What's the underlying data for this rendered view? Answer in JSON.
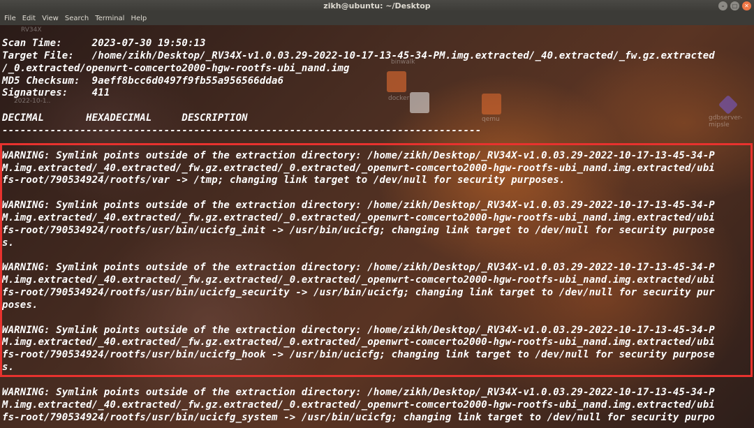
{
  "window": {
    "title": "zikh@ubuntu: ~/Desktop",
    "controls": [
      "minimize-icon",
      "maximize-icon",
      "close-icon"
    ]
  },
  "menu": [
    "File",
    "Edit",
    "View",
    "Search",
    "Terminal",
    "Help"
  ],
  "desktop_labels": [
    "binwalk",
    "qemu",
    "gdbserver-mipsle",
    "2022-10-1..",
    "RV34X",
    "docker"
  ],
  "colors": {
    "highlight": "#e8322e",
    "text": "#ffffff",
    "titlebar": "#3c3b37"
  },
  "terminal": {
    "lines": [
      "Scan Time:     2023-07-30 19:50:13",
      "Target File:   /home/zikh/Desktop/_RV34X-v1.0.03.29-2022-10-17-13-45-34-PM.img.extracted/_40.extracted/_fw.gz.extracted",
      "/_0.extracted/openwrt-comcerto2000-hgw-rootfs-ubi_nand.img",
      "MD5 Checksum:  9aeff8bcc6d0497f9fb55a956566dda6",
      "Signatures:    411",
      "",
      "DECIMAL       HEXADECIMAL     DESCRIPTION",
      "--------------------------------------------------------------------------------",
      "",
      "WARNING: Symlink points outside of the extraction directory: /home/zikh/Desktop/_RV34X-v1.0.03.29-2022-10-17-13-45-34-P",
      "M.img.extracted/_40.extracted/_fw.gz.extracted/_0.extracted/_openwrt-comcerto2000-hgw-rootfs-ubi_nand.img.extracted/ubi",
      "fs-root/790534924/rootfs/var -> /tmp; changing link target to /dev/null for security purposes.",
      "",
      "WARNING: Symlink points outside of the extraction directory: /home/zikh/Desktop/_RV34X-v1.0.03.29-2022-10-17-13-45-34-P",
      "M.img.extracted/_40.extracted/_fw.gz.extracted/_0.extracted/_openwrt-comcerto2000-hgw-rootfs-ubi_nand.img.extracted/ubi",
      "fs-root/790534924/rootfs/usr/bin/ucicfg_init -> /usr/bin/ucicfg; changing link target to /dev/null for security purpose",
      "s.",
      "",
      "WARNING: Symlink points outside of the extraction directory: /home/zikh/Desktop/_RV34X-v1.0.03.29-2022-10-17-13-45-34-P",
      "M.img.extracted/_40.extracted/_fw.gz.extracted/_0.extracted/_openwrt-comcerto2000-hgw-rootfs-ubi_nand.img.extracted/ubi",
      "fs-root/790534924/rootfs/usr/bin/ucicfg_security -> /usr/bin/ucicfg; changing link target to /dev/null for security pur",
      "poses.",
      "",
      "WARNING: Symlink points outside of the extraction directory: /home/zikh/Desktop/_RV34X-v1.0.03.29-2022-10-17-13-45-34-P",
      "M.img.extracted/_40.extracted/_fw.gz.extracted/_0.extracted/_openwrt-comcerto2000-hgw-rootfs-ubi_nand.img.extracted/ubi",
      "fs-root/790534924/rootfs/usr/bin/ucicfg_hook -> /usr/bin/ucicfg; changing link target to /dev/null for security purpose",
      "s.",
      "",
      "WARNING: Symlink points outside of the extraction directory: /home/zikh/Desktop/_RV34X-v1.0.03.29-2022-10-17-13-45-34-P",
      "M.img.extracted/_40.extracted/_fw.gz.extracted/_0.extracted/_openwrt-comcerto2000-hgw-rootfs-ubi_nand.img.extracted/ubi",
      "fs-root/790534924/rootfs/usr/bin/ucicfg_system -> /usr/bin/ucicfg; changing link target to /dev/null for security purpo"
    ]
  }
}
